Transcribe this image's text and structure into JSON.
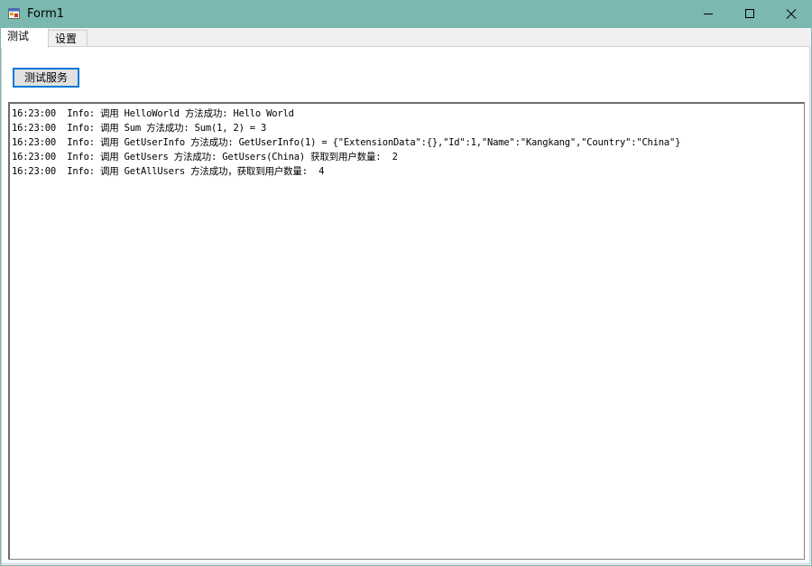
{
  "window": {
    "title": "Form1",
    "icon": "form-app-icon",
    "controls": [
      "minimize-icon",
      "maximize-icon",
      "close-icon"
    ]
  },
  "tabs": [
    {
      "label": "测试",
      "selected": true
    },
    {
      "label": "设置",
      "selected": false
    }
  ],
  "test_page": {
    "button_label": "测试服务",
    "log_lines": [
      "16:23:00  Info: 调用 HelloWorld 方法成功: Hello World",
      "16:23:00  Info: 调用 Sum 方法成功: Sum(1, 2) = 3",
      "16:23:00  Info: 调用 GetUserInfo 方法成功: GetUserInfo(1) = {\"ExtensionData\":{},\"Id\":1,\"Name\":\"Kangkang\",\"Country\":\"China\"}",
      "16:23:00  Info: 调用 GetUsers 方法成功: GetUsers(China) 获取到用户数量:  2",
      "16:23:00  Info: 调用 GetAllUsers 方法成功，获取到用户数量:  4"
    ]
  },
  "colors": {
    "titlebar": "#7ab8b0",
    "button_focus_border": "#0078d7"
  }
}
